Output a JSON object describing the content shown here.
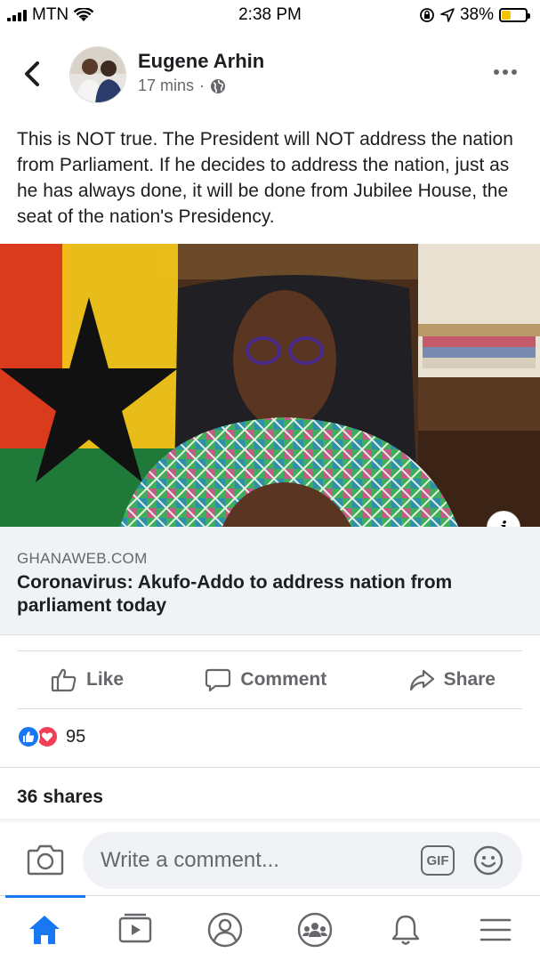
{
  "status_bar": {
    "carrier": "MTN",
    "time": "2:38 PM",
    "battery_percent": "38%",
    "battery_level": 0.38
  },
  "post": {
    "author": "Eugene Arhin",
    "time_ago": "17 mins",
    "separator": "·",
    "privacy_icon": "globe-icon",
    "text": "This is NOT true. The President will NOT address the nation from Parliament. If he decides to address the nation, just as he has always done, it will be done from Jubilee House, the seat of the nation's Presidency."
  },
  "link_preview": {
    "domain": "GHANAWEB.COM",
    "title": "Coronavirus: Akufo-Addo to address nation from parliament today",
    "info_label": "i"
  },
  "actions": {
    "like": "Like",
    "comment": "Comment",
    "share": "Share"
  },
  "engagement": {
    "reaction_count": "95",
    "shares": "36 shares"
  },
  "composer": {
    "placeholder": "Write a comment...",
    "gif_label": "GIF"
  },
  "tabs": [
    "home-icon",
    "watch-icon",
    "profile-icon",
    "groups-icon",
    "notifications-icon",
    "menu-icon"
  ],
  "colors": {
    "accent": "#1877f2",
    "love": "#f33e58",
    "battery": "#f5c400"
  }
}
